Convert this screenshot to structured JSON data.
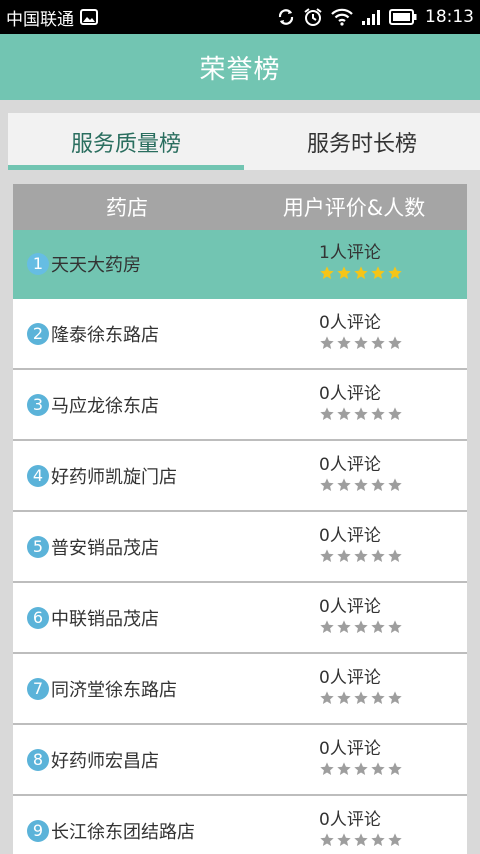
{
  "status_bar": {
    "carrier": "中国联通",
    "time": "18:13",
    "icons": [
      "image-icon",
      "sync-icon",
      "alarm-icon",
      "wifi-icon",
      "signal-icon",
      "battery-icon"
    ]
  },
  "header": {
    "title": "荣誉榜"
  },
  "tabs": [
    {
      "label": "服务质量榜",
      "active": true
    },
    {
      "label": "服务时长榜",
      "active": false
    }
  ],
  "table": {
    "columns": [
      "药店",
      "用户评价&人数"
    ],
    "rows": [
      {
        "rank": "1",
        "name": "天天大药房",
        "reviews": "1人评论",
        "stars": 5,
        "highlight": true
      },
      {
        "rank": "2",
        "name": "隆泰徐东路店",
        "reviews": "0人评论",
        "stars": 0,
        "highlight": false
      },
      {
        "rank": "3",
        "name": "马应龙徐东店",
        "reviews": "0人评论",
        "stars": 0,
        "highlight": false
      },
      {
        "rank": "4",
        "name": "好药师凯旋门店",
        "reviews": "0人评论",
        "stars": 0,
        "highlight": false
      },
      {
        "rank": "5",
        "name": "普安销品茂店",
        "reviews": "0人评论",
        "stars": 0,
        "highlight": false
      },
      {
        "rank": "6",
        "name": "中联销品茂店",
        "reviews": "0人评论",
        "stars": 0,
        "highlight": false
      },
      {
        "rank": "7",
        "name": "同济堂徐东路店",
        "reviews": "0人评论",
        "stars": 0,
        "highlight": false
      },
      {
        "rank": "8",
        "name": "好药师宏昌店",
        "reviews": "0人评论",
        "stars": 0,
        "highlight": false
      },
      {
        "rank": "9",
        "name": "长江徐东团结路店",
        "reviews": "0人评论",
        "stars": 0,
        "highlight": false
      }
    ]
  },
  "colors": {
    "accent": "#72c5b2",
    "badge": "#5bb3d9",
    "star_filled": "#f5c518",
    "star_empty": "#9e9e9e"
  }
}
